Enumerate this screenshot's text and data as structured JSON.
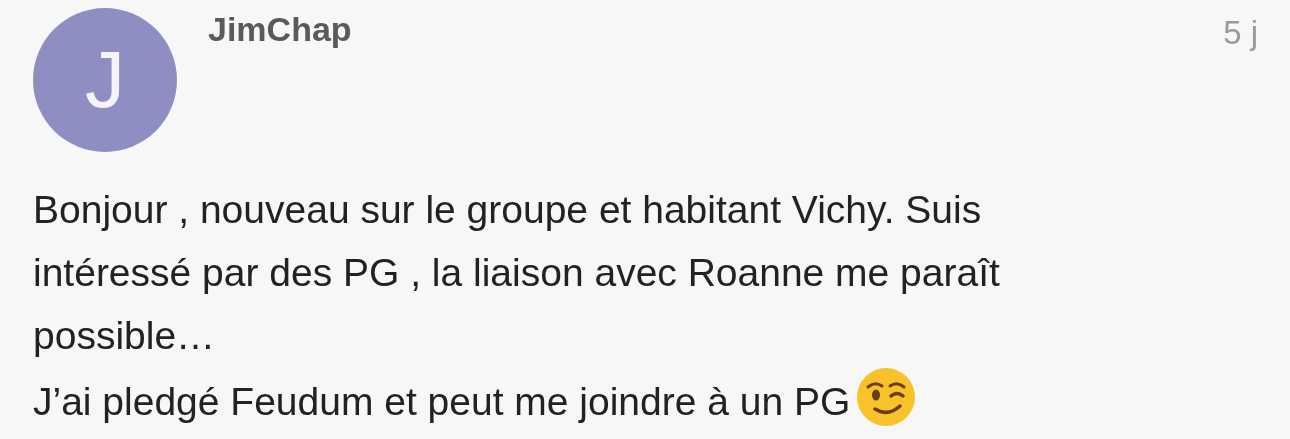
{
  "comment": {
    "avatar_letter": "J",
    "author": "JimChap",
    "time": "5 j",
    "lines": [
      {
        "text": "Bonjour , nouveau sur le groupe et habitant Vichy. Suis",
        "emoji": false
      },
      {
        "text": "intéressé par des PG , la liaison avec Roanne me paraît",
        "emoji": false
      },
      {
        "text": "possible…",
        "emoji": false
      },
      {
        "text": "J’ai pledgé Feudum et peut me joindre à un PG",
        "emoji": true
      }
    ]
  }
}
